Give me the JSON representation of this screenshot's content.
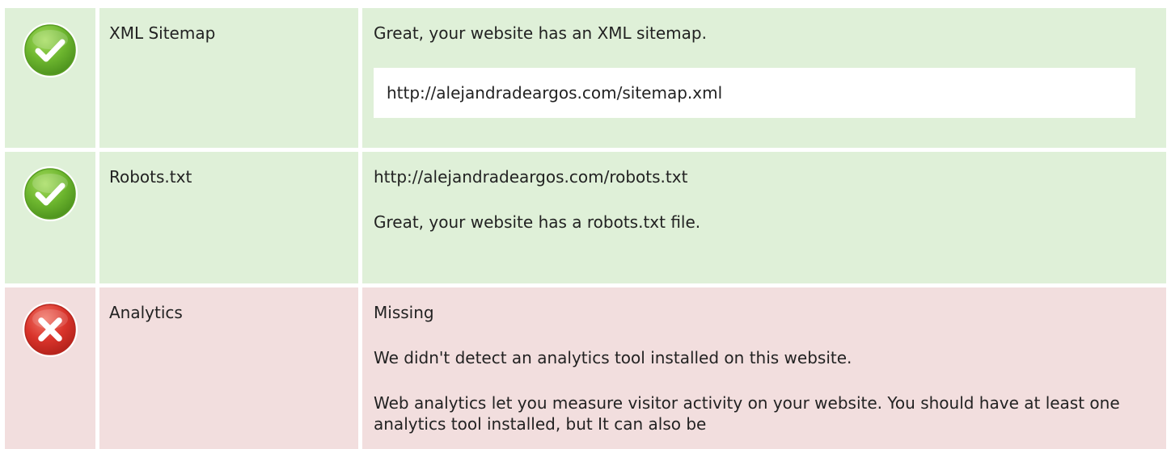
{
  "checks": [
    {
      "status": "pass",
      "icon": "check-icon",
      "name": "XML Sitemap",
      "messages": [
        "Great, your website has an XML sitemap."
      ],
      "url": "http://alejandradeargos.com/sitemap.xml"
    },
    {
      "status": "pass",
      "icon": "check-icon",
      "name": "Robots.txt",
      "messages": [
        "http://alejandradeargos.com/robots.txt",
        "Great, your website has a robots.txt file."
      ]
    },
    {
      "status": "fail",
      "icon": "cross-icon",
      "name": "Analytics",
      "messages": [
        "Missing",
        "We didn't detect an analytics tool installed on this website.",
        "Web analytics let you measure visitor activity on your website. You should have at least one analytics tool installed, but It can also be"
      ]
    }
  ],
  "colors": {
    "pass_bg": "#dff0d8",
    "fail_bg": "#f2dede",
    "pass_icon": "#6cb52e",
    "fail_icon": "#d9342b"
  }
}
